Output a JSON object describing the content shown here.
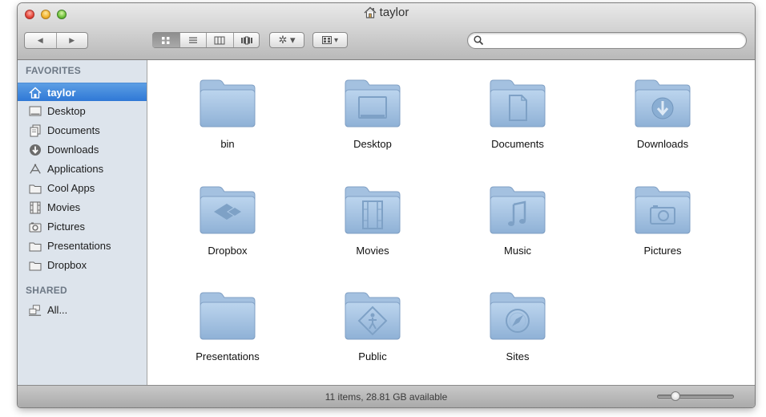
{
  "window": {
    "title": "taylor"
  },
  "toolbar": {
    "back_glyph": "◀",
    "forward_glyph": "▶",
    "view_modes": [
      "icon-view",
      "list-view",
      "column-view",
      "cover-flow-view"
    ],
    "action_glyph": "✲ ▾",
    "arrange_glyph": "▾",
    "search": {
      "value": "",
      "placeholder": ""
    }
  },
  "sidebar": {
    "favorites_label": "FAVORITES",
    "shared_label": "SHARED",
    "items": [
      {
        "label": "taylor",
        "icon": "home-icon",
        "selected": true
      },
      {
        "label": "Desktop",
        "icon": "desktop-icon"
      },
      {
        "label": "Documents",
        "icon": "documents-icon"
      },
      {
        "label": "Downloads",
        "icon": "downloads-icon"
      },
      {
        "label": "Applications",
        "icon": "applications-icon"
      },
      {
        "label": "Cool Apps",
        "icon": "folder-icon"
      },
      {
        "label": "Movies",
        "icon": "movies-icon"
      },
      {
        "label": "Pictures",
        "icon": "pictures-icon"
      },
      {
        "label": "Presentations",
        "icon": "folder-icon"
      },
      {
        "label": "Dropbox",
        "icon": "folder-icon"
      }
    ],
    "shared_items": [
      {
        "label": "All...",
        "icon": "network-icon"
      }
    ]
  },
  "files": [
    {
      "label": "bin",
      "emblem": "none"
    },
    {
      "label": "Desktop",
      "emblem": "desktop"
    },
    {
      "label": "Documents",
      "emblem": "document"
    },
    {
      "label": "Downloads",
      "emblem": "download"
    },
    {
      "label": "Dropbox",
      "emblem": "dropbox"
    },
    {
      "label": "Movies",
      "emblem": "film"
    },
    {
      "label": "Music",
      "emblem": "music"
    },
    {
      "label": "Pictures",
      "emblem": "camera"
    },
    {
      "label": "Presentations",
      "emblem": "none"
    },
    {
      "label": "Public",
      "emblem": "public"
    },
    {
      "label": "Sites",
      "emblem": "compass"
    }
  ],
  "status": {
    "text": "11 items, 28.81 GB available",
    "zoom_level": 0.2
  },
  "colors": {
    "selection": "#3a82da",
    "sidebar_bg": "#dde4ec",
    "folder": "#a8c6e4"
  }
}
